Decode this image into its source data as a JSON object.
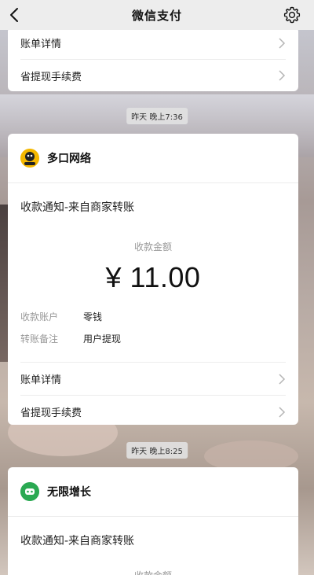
{
  "header": {
    "title": "微信支付"
  },
  "top_card": {
    "rows": [
      {
        "label": "账单详情"
      },
      {
        "label": "省提现手续费"
      }
    ]
  },
  "messages": [
    {
      "time": "昨天 晚上7:36",
      "merchant": "多口网络",
      "logo_color": "#f5b800",
      "title": "收款通知-来自商家转账",
      "amount_label": "收款金额",
      "amount": "¥ 11.00",
      "details": [
        {
          "key": "收款账户",
          "value": "零钱"
        },
        {
          "key": "转账备注",
          "value": "用户提现"
        }
      ],
      "rows": [
        {
          "label": "账单详情"
        },
        {
          "label": "省提现手续费"
        }
      ]
    },
    {
      "time": "昨天 晚上8:25",
      "merchant": "无限增长",
      "logo_color": "#2aa952",
      "title": "收款通知-来自商家转账",
      "amount_label": "收款金额"
    }
  ],
  "icons": {
    "back": "back-arrow-icon",
    "settings": "gear-icon",
    "chevron": "chevron-right-icon"
  }
}
